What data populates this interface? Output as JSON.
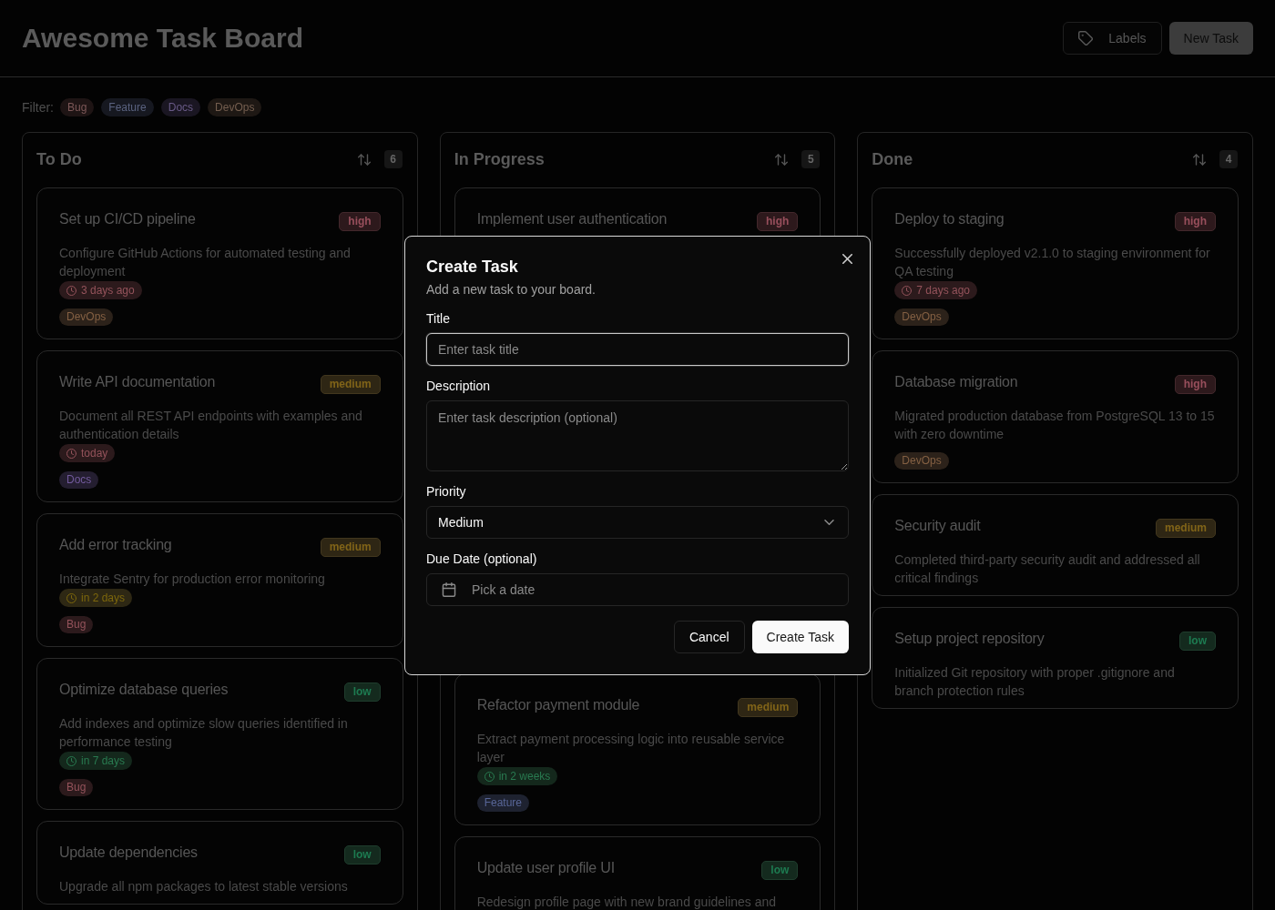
{
  "header": {
    "title": "Awesome Task Board",
    "labels_button": "Labels",
    "new_task_button": "New Task"
  },
  "filter": {
    "label": "Filter:",
    "tags": [
      {
        "label": "Bug",
        "color": "#1e1414"
      },
      {
        "label": "Feature",
        "color": "#161820"
      },
      {
        "label": "Docs",
        "color": "#1a1622"
      },
      {
        "label": "DevOps",
        "color": "#1e1814"
      }
    ]
  },
  "columns": [
    {
      "title": "To Do",
      "count": "6",
      "cards": [
        {
          "title": "Set up CI/CD pipeline",
          "priority": {
            "label": "high",
            "color": "#2d191c"
          },
          "description": "Configure GitHub Actions for automated testing and deployment",
          "due": {
            "label": "3 days ago",
            "color": "#2c1a1c"
          },
          "tags": [
            {
              "label": "DevOps",
              "color": "#2c221a"
            }
          ]
        },
        {
          "title": "Write API documentation",
          "priority": {
            "label": "medium",
            "color": "#2e2614"
          },
          "description": "Document all REST API endpoints with examples and authentication details",
          "due": {
            "label": "today",
            "color": "#2c1a1c"
          },
          "tags": [
            {
              "label": "Docs",
              "color": "#241e30"
            }
          ]
        },
        {
          "title": "Add error tracking",
          "priority": {
            "label": "medium",
            "color": "#2e2614"
          },
          "description": "Integrate Sentry for production error monitoring",
          "due": {
            "label": "in 2 days",
            "color": "#2e2814"
          },
          "tags": [
            {
              "label": "Bug",
              "color": "#2c1a1c"
            }
          ]
        },
        {
          "title": "Optimize database queries",
          "priority": {
            "label": "low",
            "color": "#142a1e"
          },
          "description": "Add indexes and optimize slow queries identified in performance testing",
          "due": {
            "label": "in 7 days",
            "color": "#14281c"
          },
          "tags": [
            {
              "label": "Bug",
              "color": "#2c1a1c"
            }
          ]
        },
        {
          "title": "Update dependencies",
          "priority": {
            "label": "low",
            "color": "#142a1e"
          },
          "description": "Upgrade all npm packages to latest stable versions"
        }
      ]
    },
    {
      "title": "In Progress",
      "count": "5",
      "cards": [
        {
          "title": "Implement user authentication",
          "priority": {
            "label": "high",
            "color": "#2d191c"
          }
        },
        {
          "title": "Refactor payment module",
          "priority": {
            "label": "medium",
            "color": "#2e2614"
          },
          "description": "Extract payment processing logic into reusable service layer",
          "due": {
            "label": "in 2 weeks",
            "color": "#14281c"
          },
          "tags": [
            {
              "label": "Feature",
              "color": "#1e2230"
            }
          ]
        },
        {
          "title": "Update user profile UI",
          "priority": {
            "label": "low",
            "color": "#142a1e"
          },
          "description": "Redesign profile page with new brand guidelines and"
        }
      ]
    },
    {
      "title": "Done",
      "count": "4",
      "cards": [
        {
          "title": "Deploy to staging",
          "priority": {
            "label": "high",
            "color": "#2d191c"
          },
          "description": "Successfully deployed v2.1.0 to staging environment for QA testing",
          "due": {
            "label": "7 days ago",
            "color": "#2c1a1c"
          },
          "tags": [
            {
              "label": "DevOps",
              "color": "#2c221a"
            }
          ]
        },
        {
          "title": "Database migration",
          "priority": {
            "label": "high",
            "color": "#2d191c"
          },
          "description": "Migrated production database from PostgreSQL 13 to 15 with zero downtime",
          "tags": [
            {
              "label": "DevOps",
              "color": "#2c221a"
            }
          ]
        },
        {
          "title": "Security audit",
          "priority": {
            "label": "medium",
            "color": "#2e2614"
          },
          "description": "Completed third-party security audit and addressed all critical findings"
        },
        {
          "title": "Setup project repository",
          "priority": {
            "label": "low",
            "color": "#142a1e"
          },
          "description": "Initialized Git repository with proper .gitignore and branch protection rules"
        }
      ]
    }
  ],
  "dialog": {
    "title": "Create Task",
    "subtitle": "Add a new task to your board.",
    "fields": [
      {
        "kind": "text",
        "label": "Title",
        "placeholder": "Enter task title",
        "focused": true
      },
      {
        "kind": "textarea",
        "label": "Description",
        "placeholder": "Enter task description (optional)",
        "focused": false
      },
      {
        "kind": "select",
        "label": "Priority",
        "value": "Medium",
        "focused": false
      },
      {
        "kind": "date",
        "label": "Due Date (optional)",
        "placeholder": "Pick a date",
        "focused": false
      }
    ],
    "cancel_button": "Cancel",
    "submit_button": "Create Task"
  }
}
